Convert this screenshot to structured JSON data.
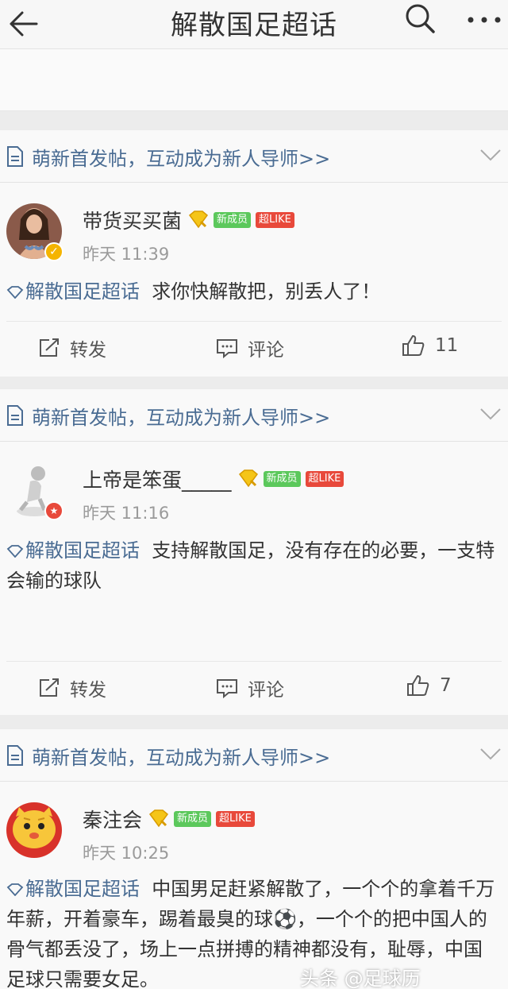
{
  "topbar": {
    "title": "解散国足超话"
  },
  "posts": [
    {
      "header_text": "萌新首发帖，互动成为新人导师>>",
      "username": "带货买买菌",
      "tag_new": "新成员",
      "tag_like": "超LIKE",
      "time": "昨天 11:39",
      "topic": "解散国足超话",
      "content": "求你快解散把，别丢人了！",
      "repost_label": "转发",
      "comment_label": "评论",
      "likes": "11"
    },
    {
      "header_text": "萌新首发帖，互动成为新人导师>>",
      "username": "上帝是笨蛋_____",
      "tag_new": "新成员",
      "tag_like": "超LIKE",
      "time": "昨天 11:16",
      "topic": "解散国足超话",
      "content": "支持解散国足，没有存在的必要，一支特会输的球队",
      "repost_label": "转发",
      "comment_label": "评论",
      "likes": "7"
    },
    {
      "header_text": "萌新首发帖，互动成为新人导师>>",
      "username": "秦注会",
      "tag_new": "新成员",
      "tag_like": "超LIKE",
      "time": "昨天 10:25",
      "topic": "解散国足超话",
      "content": "中国男足赶紧解散了，一个个的拿着千万年薪，开着豪车，踢着最臭的球⚽，一个个的把中国人的骨气都丢没了，场上一点拼搏的精神都没有，耻辱，中国足球只需要女足。"
    }
  ],
  "watermark": "头条 @足球历",
  "colors": {
    "link": "#4a6c93",
    "tag_new": "#5cc85c",
    "tag_like": "#e8493b",
    "badge_gold": "#f5b400"
  }
}
